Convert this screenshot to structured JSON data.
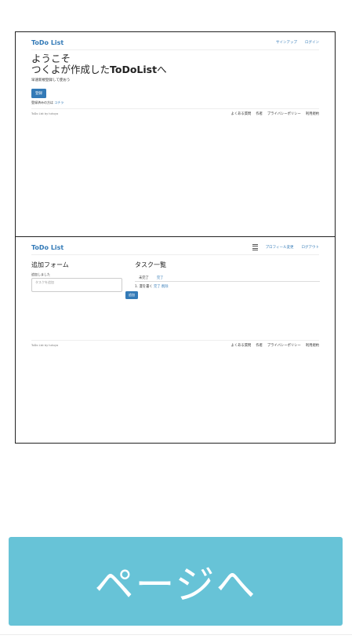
{
  "top_screen": {
    "brand": "ToDo List",
    "nav": [
      "サインアップ",
      "ログイン"
    ],
    "welcome_line1": "ようこそ",
    "welcome_line2_prefix": "つくよが作成した",
    "welcome_line2_bold": "ToDoList",
    "welcome_line2_suffix": "へ",
    "subtitle": "早速新規登録して使おう",
    "register_button": "登録",
    "login_hint_prefix": "登録済みの方は",
    "login_hint_link": "コチラ",
    "footer_copy": "ToDo List by tukuyo",
    "footer_links": [
      "よくある質問",
      "作者",
      "プライバシーポリシー",
      "利用規約"
    ]
  },
  "bottom_screen": {
    "brand": "ToDo List",
    "nav": [
      "プロフィール変更",
      "ログアウト"
    ],
    "add_form_title": "追加フォーム",
    "added_message": "追加しました",
    "task_placeholder": "タスクを追加",
    "add_button": "追加",
    "task_list_title": "タスク一覧",
    "tabs": [
      "未完了",
      "完了"
    ],
    "task_row": {
      "number": "1.",
      "text": "漫を書く",
      "done_link": "完了",
      "delete_link": "削除"
    },
    "footer_copy": "ToDo List by tukuyo",
    "footer_links": [
      "よくある質問",
      "作者",
      "プライバシーポリシー",
      "利用規約"
    ]
  },
  "cta": {
    "label": "ページへ",
    "color": "#67c3d7"
  },
  "theme": {
    "link_color": "#337ab7"
  }
}
